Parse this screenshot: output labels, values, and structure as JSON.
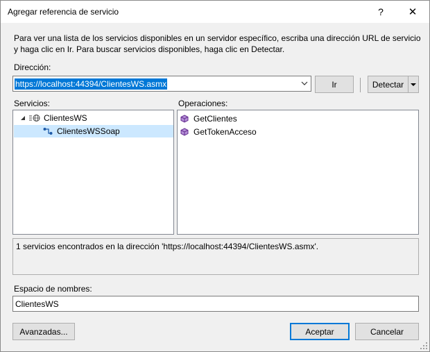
{
  "window": {
    "title": "Agregar referencia de servicio",
    "help_glyph": "?",
    "close_glyph": "✕"
  },
  "description": "Para ver una lista de los servicios disponibles en un servidor específico, escriba una dirección URL de servicio y haga clic en Ir. Para buscar servicios disponibles, haga clic en Detectar.",
  "address": {
    "label": "Dirección:",
    "value": "https://localhost:44394/ClientesWS.asmx",
    "go_label": "Ir",
    "discover_label": "Detectar"
  },
  "services": {
    "label": "Servicios:",
    "items": [
      {
        "label": "ClientesWS",
        "icon": "web-service-icon",
        "expanded": true
      },
      {
        "label": "ClientesWSSoap",
        "icon": "soap-endpoint-icon",
        "selected": true
      }
    ]
  },
  "operations": {
    "label": "Operaciones:",
    "items": [
      {
        "label": "GetClientes",
        "icon": "method-cube-icon"
      },
      {
        "label": "GetTokenAcceso",
        "icon": "method-cube-icon"
      }
    ]
  },
  "status": {
    "text": "1 servicios encontrados en la dirección 'https://localhost:44394/ClientesWS.asmx'."
  },
  "namespace": {
    "label": "Espacio de nombres:",
    "value": "ClientesWS"
  },
  "footer": {
    "advanced_label": "Avanzadas...",
    "ok_label": "Aceptar",
    "cancel_label": "Cancelar"
  },
  "colors": {
    "selection": "#0078d7",
    "tree_selected": "#cce8ff",
    "method_icon": "#652d90"
  }
}
